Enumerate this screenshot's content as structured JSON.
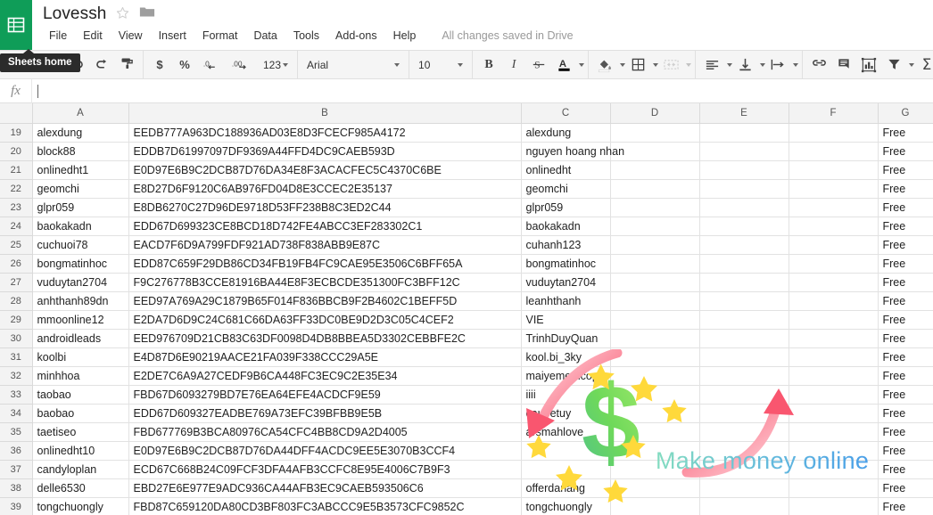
{
  "window": {
    "app_icon": "sheets-grid-icon",
    "doc_title": "Lovessh",
    "star_icon": "star-outline-icon",
    "folder_icon": "folder-icon",
    "save_status": "All changes saved in Drive",
    "brand_green": "#0F9D58"
  },
  "menubar": {
    "items": [
      {
        "label": "File"
      },
      {
        "label": "Edit"
      },
      {
        "label": "View"
      },
      {
        "label": "Insert"
      },
      {
        "label": "Format"
      },
      {
        "label": "Data"
      },
      {
        "label": "Tools"
      },
      {
        "label": "Add-ons"
      },
      {
        "label": "Help"
      }
    ]
  },
  "tooltip": {
    "text": "Sheets home"
  },
  "toolbar": {
    "print_label": "print-icon",
    "undo_label": "undo-icon",
    "redo_label": "redo-icon",
    "paint_label": "paint-format-icon",
    "currency_label": "$",
    "percent_label": "%",
    "decrease_decimal_label": ".0",
    "increase_decimal_label": ".00",
    "number_format_label": "123",
    "font_family_value": "Arial",
    "font_size_value": "10",
    "bold_label": "B",
    "italic_label": "I",
    "strikethrough_label": "S",
    "text_color_label": "A",
    "fill_color_label": "fill-color-icon",
    "borders_label": "borders-icon",
    "merge_label": "merge-cells-icon",
    "align_label": "horizontal-align-icon",
    "valign_label": "vertical-align-icon",
    "wrap_label": "text-wrap-icon",
    "link_label": "insert-link-icon",
    "comment_label": "insert-comment-icon",
    "chart_label": "insert-chart-icon",
    "filter_label": "filter-icon",
    "functions_label": "sigma-icon"
  },
  "formula_bar": {
    "fx_label": "fx",
    "value": "",
    "placeholder": ""
  },
  "grid": {
    "columns": [
      "A",
      "B",
      "C",
      "D",
      "E",
      "F",
      "G"
    ],
    "rows": [
      {
        "num": "19",
        "A": "alexdung",
        "B": "EEDB777A963DC188936AD03E8D3FCECF985A4172",
        "C": "alexdung",
        "D": "",
        "E": "",
        "F": "",
        "G": "Free"
      },
      {
        "num": "20",
        "A": "block88",
        "B": "EDDB7D61997097DF9369A44FFD4DC9CAEB593D",
        "C": "nguyen hoang nhan",
        "D": "",
        "E": "",
        "F": "",
        "G": "Free"
      },
      {
        "num": "21",
        "A": "onlinedht1",
        "B": "E0D97E6B9C2DCB87D76DA34E8F3ACACFEC5C4370C6BE",
        "C": "onlinedht",
        "D": "",
        "E": "",
        "F": "",
        "G": "Free"
      },
      {
        "num": "22",
        "A": "geomchi",
        "B": "E8D27D6F9120C6AB976FD04D8E3CCEC2E35137",
        "C": "geomchi",
        "D": "",
        "E": "",
        "F": "",
        "G": "Free"
      },
      {
        "num": "23",
        "A": "glpr059",
        "B": "E8DB6270C27D96DE9718D53FF238B8C3ED2C44",
        "C": "glpr059",
        "D": "",
        "E": "",
        "F": "",
        "G": "Free"
      },
      {
        "num": "24",
        "A": "baokakadn",
        "B": "EDD67D699323CE8BCD18D742FE4ABCC3EF283302C1",
        "C": "baokakadn",
        "D": "",
        "E": "",
        "F": "",
        "G": "Free"
      },
      {
        "num": "25",
        "A": "cuchuoi78",
        "B": "EACD7F6D9A799FDF921AD738F838ABB9E87C",
        "C": "cuhanh123",
        "D": "",
        "E": "",
        "F": "",
        "G": "Free"
      },
      {
        "num": "26",
        "A": "bongmatinhoc",
        "B": "EDD87C659F29DB86CD34FB19FB4FC9CAE95E3506C6BFF65A",
        "C": "bongmatinhoc",
        "D": "",
        "E": "",
        "F": "",
        "G": "Free"
      },
      {
        "num": "27",
        "A": "vuduytan2704",
        "B": "F9C276778B3CCE81916BA44E8F3ECBCDE351300FC3BFF12C",
        "C": "vuduytan2704",
        "D": "",
        "E": "",
        "F": "",
        "G": "Free"
      },
      {
        "num": "28",
        "A": "anhthanh89dn",
        "B": "EED97A769A29C1879B65F014F836BBCB9F2B4602C1BEFF5D",
        "C": "leanhthanh",
        "D": "",
        "E": "",
        "F": "",
        "G": "Free"
      },
      {
        "num": "29",
        "A": "mmoonline12",
        "B": "E2DA7D6D9C24C681C66DA63FF33DC0BE9D2D3C05C4CEF2",
        "C": "VIE",
        "D": "",
        "E": "",
        "F": "",
        "G": "Free"
      },
      {
        "num": "30",
        "A": "androidleads",
        "B": "EED976709D21CB83C63DF0098D4DB8BBEA5D3302CEBBFE2C",
        "C": "TrinhDuyQuan",
        "D": "",
        "E": "",
        "F": "",
        "G": "Free"
      },
      {
        "num": "31",
        "A": "koolbi",
        "B": "E4D87D6E90219AACE21FA039F338CCC29A5E",
        "C": "kool.bi_3ky",
        "D": "",
        "E": "",
        "F": "",
        "G": "Free"
      },
      {
        "num": "32",
        "A": "minhhoa",
        "B": "E2DE7C6A9A27CEDF9B6CA448FC3EC9C2E35E34",
        "C": "maiyememcope",
        "D": "",
        "E": "",
        "F": "",
        "G": "Free"
      },
      {
        "num": "33",
        "A": "taobao",
        "B": "FBD67D6093279BD7E76EA64EFE4ACDCF9E59",
        "C": "iiii",
        "D": "",
        "E": "",
        "F": "",
        "G": "Free"
      },
      {
        "num": "34",
        "A": "baobao",
        "B": "EDD67D609327EADBE769A73EFC39BFBB9E5B",
        "C": "caubetuy",
        "D": "",
        "E": "",
        "F": "",
        "G": "Free"
      },
      {
        "num": "35",
        "A": "taetiseo",
        "B": "FBD677769B3BCA80976CA54CFC4BB8CD9A2D4005",
        "C": "arsmahlove",
        "D": "",
        "E": "",
        "F": "",
        "G": "Free"
      },
      {
        "num": "36",
        "A": "onlinedht10",
        "B": "E0D97E6B9C2DCB87D76DA44DFF4ACDC9EE5E3070B3CCF4",
        "C": "",
        "D": "",
        "E": "",
        "F": "",
        "G": "Free"
      },
      {
        "num": "37",
        "A": "candyloplan",
        "B": "ECD67C668B24C09FCF3DFA4AFB3CCFC8E95E4006C7B9F3",
        "C": "",
        "D": "",
        "E": "",
        "F": "",
        "G": "Free"
      },
      {
        "num": "38",
        "A": "delle6530",
        "B": "EBD27E6E977E9ADC936CA44AFB3EC9CAEB593506C6",
        "C": "offerdanang",
        "D": "",
        "E": "",
        "F": "",
        "G": "Free"
      },
      {
        "num": "39",
        "A": "tongchuongly",
        "B": "FBD87C659120DA80CD3BF803FC3ABCCC9E5B3573CFC9852C",
        "C": "tongchuongly",
        "D": "",
        "E": "",
        "F": "",
        "G": "Free"
      }
    ]
  },
  "watermark": {
    "text": "Make money online",
    "dollar_icon": "dollar-sign-icon",
    "arrow_left_icon": "curved-arrow-down-icon",
    "arrow_right_icon": "curved-arrow-up-icon",
    "star_icon": "star-icon",
    "gradient_start": "#5fd94f",
    "gradient_end": "#6fd0b8",
    "text_gradient_start": "#7ed9c0",
    "text_gradient_end": "#5aa8e8",
    "arrow_color": "#f96b84"
  }
}
